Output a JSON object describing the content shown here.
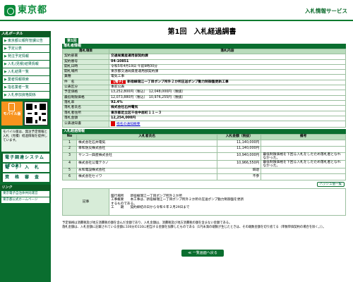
{
  "header": {
    "logo_text": "東京都",
    "service_title": "入札情報サービス"
  },
  "sidebar": {
    "head": "入札ポータル",
    "items": [
      "東京都公報所管課公告",
      "予定公表",
      "発注予定情報",
      "入札(見積)結果情報",
      "入札結果一覧",
      "業者情報検索",
      "指名業者一覧",
      "入札参加資格関係"
    ],
    "mobile_label": "モバイル版",
    "mobile_note": "モバイル版は、発注予定情報と入札（見積）経過情報を提供しています。",
    "big_items": [
      "電子調達システム(TOP)",
      "電　子　入　札",
      "資　格　審　査"
    ],
    "link_head": "リンク",
    "links": [
      "東京電子自治体共同運営",
      "東京都公式ホームページ"
    ]
  },
  "main": {
    "title": "第1回　入札経過調書",
    "round_badge": "第1回",
    "info_section": "落札者情報",
    "info_headers": [
      "落札項目",
      "落札内容"
    ],
    "info_rows": [
      {
        "label": "契約部署",
        "value": "交通局資産運用部契約課",
        "bold": true
      },
      {
        "label": "契約番号",
        "value": "04-10851",
        "bold": true
      },
      {
        "label": "開札日時",
        "value": "令和5年4月19日 午前9時30分"
      },
      {
        "label": "開札場所",
        "value": "東京都交通局資産運用部契約課"
      },
      {
        "label": "業種",
        "value": "電気工事"
      },
      {
        "label": "件　名",
        "tag": "【電子】",
        "value": "新宿線瑞江一丁目ポンプ所外２か所圧送ポンプ動力制御盤更新工事",
        "bold": true
      },
      {
        "label": "公表区分",
        "value": "事前公表"
      },
      {
        "label": "予定価格",
        "value": "13,252,800円（税込）　12,048,000円（税抜）"
      },
      {
        "label": "最低制限価格",
        "value": "12,073,880円（税込）　10,976,255円（税抜）"
      },
      {
        "label": "落札率",
        "value": "92.4%",
        "bold": true
      },
      {
        "label": "落札者氏名",
        "value": "株式会社石井電気",
        "bold": true
      },
      {
        "label": "落札者住所",
        "value": "東京都足立区千住中居町１１－３",
        "bold": true
      },
      {
        "label": "落札金額",
        "value": "12,254,000円",
        "bold": true
      },
      {
        "label": "公表通知書",
        "value": "指名の通知概要",
        "link": true
      }
    ],
    "bid_section": "入札経過情報",
    "bid_headers": [
      "No",
      "入札者氏名",
      "入札金額（税抜）",
      "備考"
    ],
    "bids": [
      {
        "no": "1",
        "name": "株式会社石井電気",
        "amount": "11,140,000円",
        "note": ""
      },
      {
        "no": "2",
        "name": "幸和防災株式会社",
        "amount": "11,140,000円",
        "note": ""
      },
      {
        "no": "3",
        "name": "サンコー興産株式会社",
        "amount": "10,940,000円",
        "note": "最低制限価格を下回る入札をしたため落札者となれなかった。"
      },
      {
        "no": "4",
        "name": "株式会社公電テクノ",
        "amount": "10,966,550円",
        "note": "最低制限価格を下回る入札をしたため落札者となれなかった。"
      },
      {
        "no": "5",
        "name": "永和電設株式会社",
        "amount": "辞退",
        "note": ""
      },
      {
        "no": "6",
        "name": "株式会社セイワ",
        "amount": "不参",
        "note": ""
      }
    ],
    "hash_button": "ハッシュ値一覧",
    "remarks_label": "記事",
    "remarks_text": "履行場所　　新宿線瑞江一丁目ポンプ所外２か所\n工事概要　　本工事は、新宿線瑞江一丁目ポンプ所外２か所の圧送ポンプ動力制御盤を更新\nするものである。\n工　　期　　契約締結の日から令和６年２月29日まで",
    "footnotes": [
      "予定価格は消費税及び地方消費税の額を含んだ金額であり、入札金額は、消費税及び地方消費税の額を含まない金額である。",
      "落札金額は、入札金額に記載されている金額に100分の110に相当する金額を加算したものである（1円未満の端数が生じたときは、その端数金額を切り捨てる（単数単価契約の場合を除く。））。"
    ],
    "back_button": "≪ 一覧画面へ戻る"
  }
}
